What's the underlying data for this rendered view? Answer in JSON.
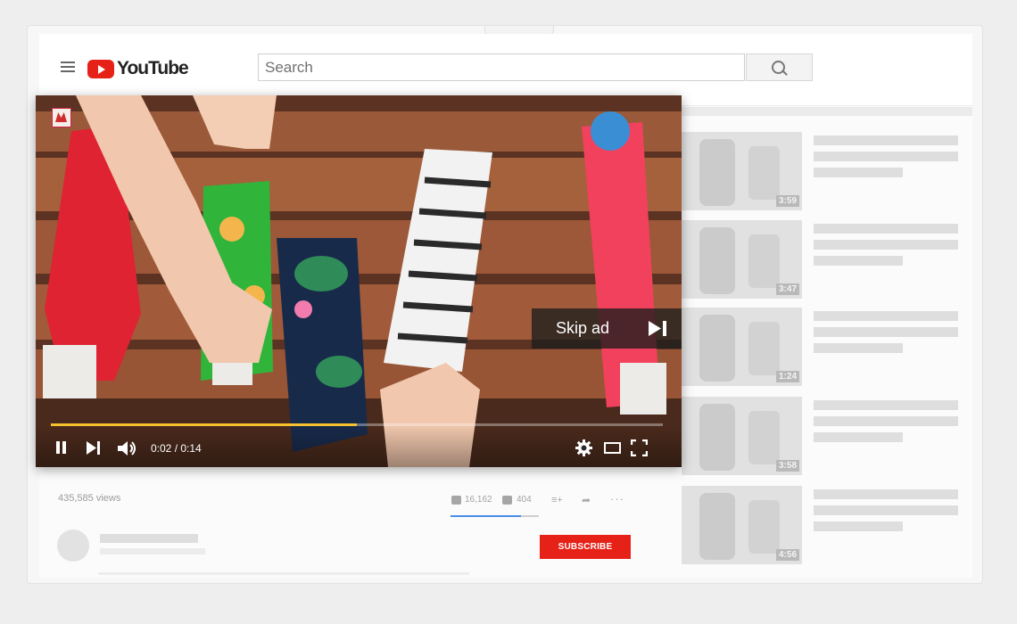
{
  "header": {
    "logo_text": "YouTube",
    "search_placeholder": "Search"
  },
  "player": {
    "skip_label": "Skip ad",
    "time": "0:02 / 0:14",
    "progress": 0.5
  },
  "video_info": {
    "views": "435,585 views",
    "likes": "16,162",
    "dislikes": "404",
    "like_ratio": 0.8,
    "subscribe_label": "SUBSCRIBE"
  },
  "recommendations": [
    {
      "duration": "3:59"
    },
    {
      "duration": "3:47"
    },
    {
      "duration": "1:24"
    },
    {
      "duration": "3:58"
    },
    {
      "duration": "4:56"
    }
  ],
  "colors": {
    "brand_red": "#e62117",
    "progress_yellow": "#f6c22d",
    "like_blue": "#4a8ee8"
  },
  "icons": [
    "menu-icon",
    "youtube-logo-icon",
    "search-icon",
    "pause-icon",
    "next-icon",
    "volume-icon",
    "settings-icon",
    "theater-icon",
    "fullscreen-icon",
    "skip-next-icon",
    "thumbs-up-icon",
    "thumbs-down-icon",
    "add-to-playlist-icon",
    "share-icon",
    "more-icon"
  ]
}
